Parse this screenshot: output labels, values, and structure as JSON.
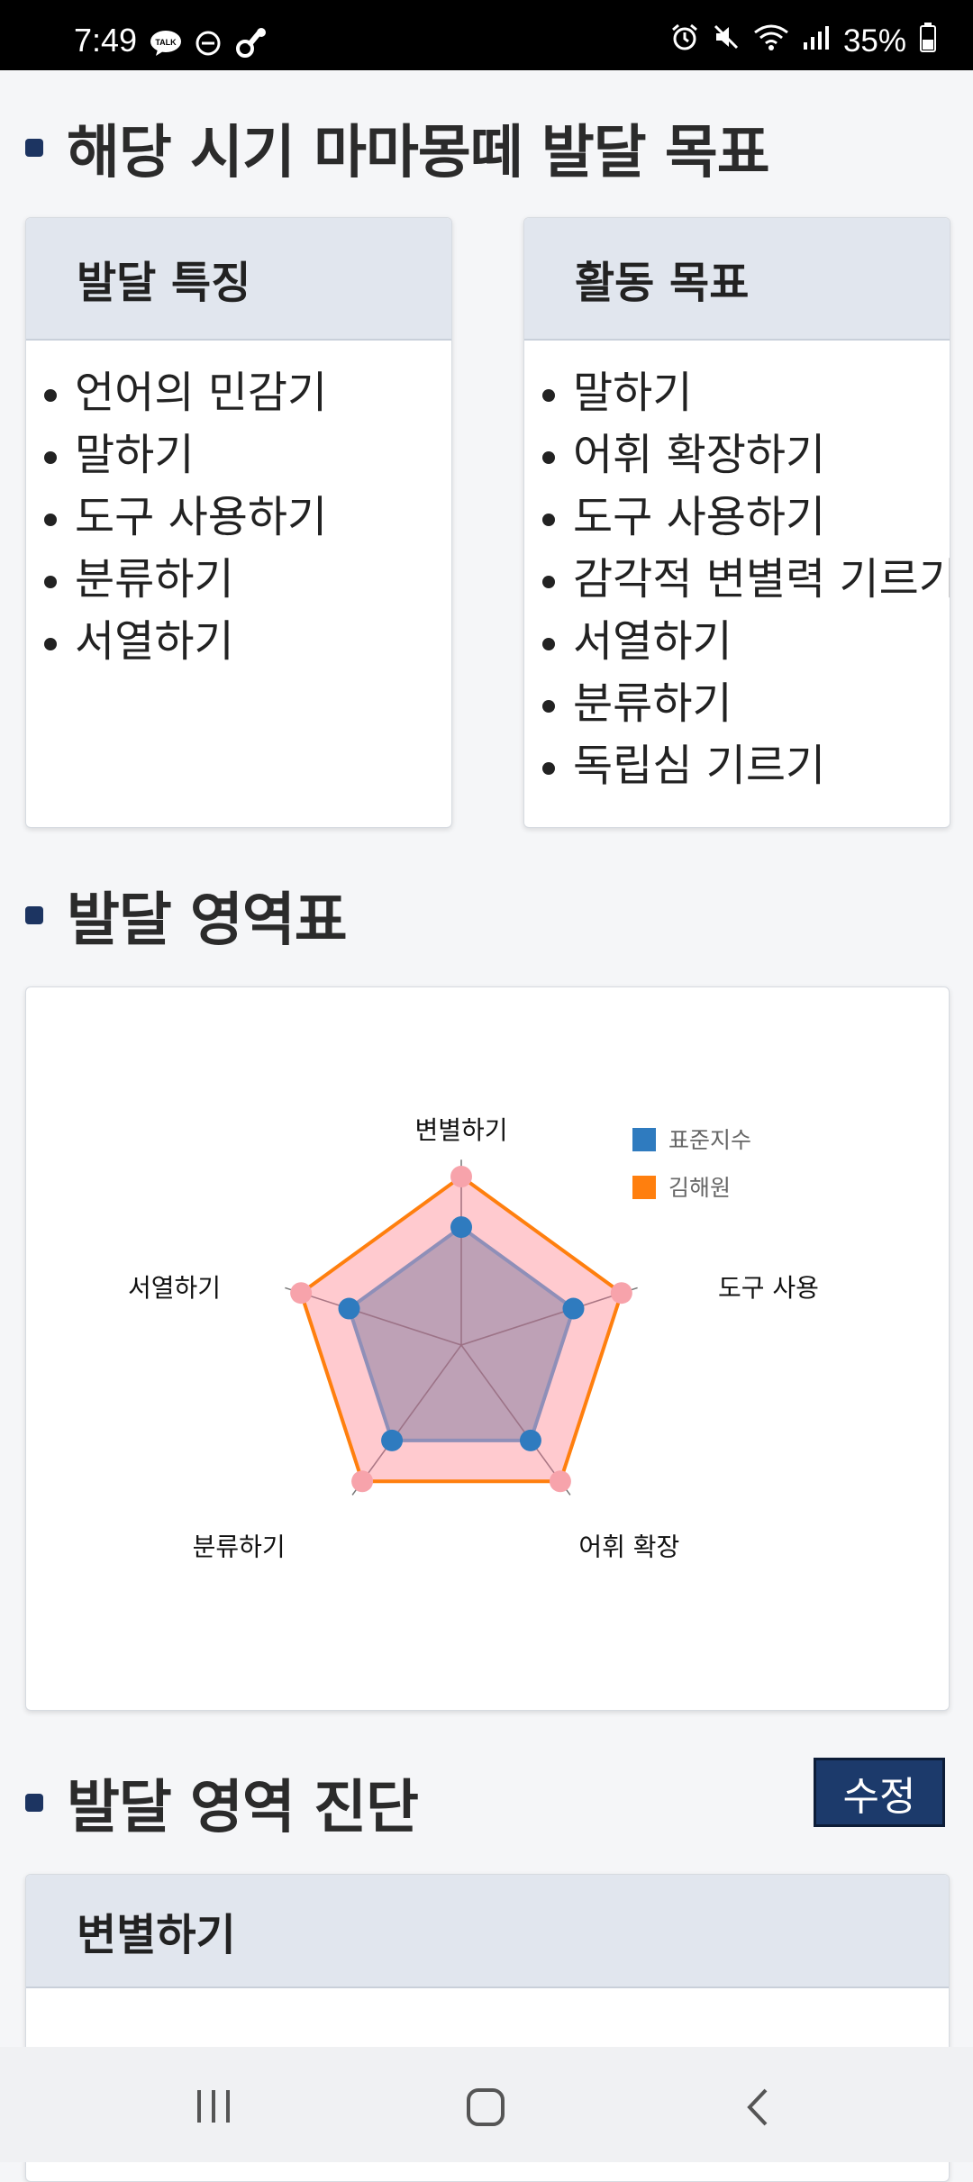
{
  "status_bar": {
    "time": "7:49",
    "battery": "35%",
    "left_icons": [
      "kakaotalk-icon",
      "dnd-icon",
      "pacifier-icon"
    ],
    "right_icons": [
      "alarm-icon",
      "mute-icon",
      "wifi-icon",
      "signal-icon",
      "battery-icon"
    ]
  },
  "goals_section": {
    "title": "해당 시기 마마몽떼 발달 목표",
    "features_card": {
      "header": "발달 특징",
      "items": [
        "언어의 민감기",
        "말하기",
        "도구 사용하기",
        "분류하기",
        "서열하기"
      ]
    },
    "activity_card": {
      "header": "활동 목표",
      "items": [
        "말하기",
        "어휘 확장하기",
        "도구 사용하기",
        "감각적 변별력 기르기",
        "서열하기",
        "분류하기",
        "독립심 기르기"
      ]
    }
  },
  "chart_section": {
    "title": "발달 영역표"
  },
  "chart_data": {
    "type": "radar",
    "categories": [
      "변별하기",
      "도구 사용",
      "어휘 확장",
      "분류하기",
      "서열하기"
    ],
    "rmax": 100,
    "series": [
      {
        "name": "표준지수",
        "values": [
          70,
          70,
          70,
          70,
          70
        ],
        "color": "#2f7bbf"
      },
      {
        "name": "김해원",
        "values": [
          100,
          100,
          100,
          100,
          100
        ],
        "color": "#ff7f0e"
      }
    ],
    "legend_position": "top-right"
  },
  "diagnosis_section": {
    "title": "발달 영역 진단",
    "edit_button": "수정",
    "card_header": "변별하기"
  },
  "nav_bar": {
    "icons": [
      "recent-apps-icon",
      "home-icon",
      "back-icon"
    ]
  }
}
